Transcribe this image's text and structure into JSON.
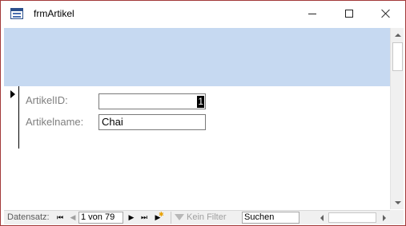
{
  "window": {
    "title": "frmArtikel",
    "icon": "form-icon",
    "buttons": {
      "minimize": "minimize-icon",
      "maximize": "maximize-icon",
      "close": "close-icon"
    }
  },
  "form": {
    "header_color": "#c6d9f1",
    "fields": {
      "artikel_id_label": "ArtikelID:",
      "artikel_id_value": "1",
      "artikelname_label": "Artikelname:",
      "artikelname_value": "Chai"
    }
  },
  "navigation": {
    "label": "Datensatz:",
    "first": "⏮",
    "prev": "◀",
    "record": "1 von 79",
    "next": "▶",
    "last": "⏭",
    "new": "▶",
    "filter": "Kein Filter",
    "search_placeholder": "Suchen"
  }
}
